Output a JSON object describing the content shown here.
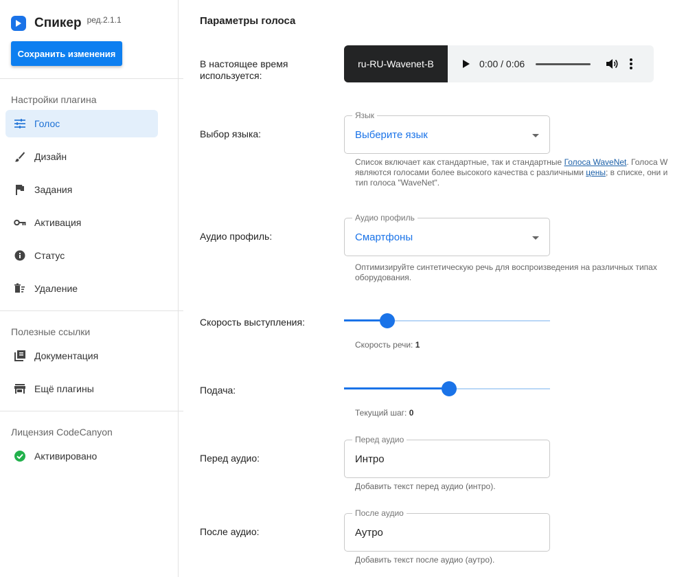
{
  "sidebar": {
    "app_name": "Спикер",
    "version": "ред.2.1.1",
    "save_label": "Сохранить изменения",
    "sections": {
      "plugin_settings": "Настройки плагина",
      "useful_links": "Полезные ссылки",
      "license": "Лицензия CodeCanyon"
    },
    "items": [
      {
        "label": "Голос",
        "icon": "sliders-icon",
        "active": true
      },
      {
        "label": "Дизайн",
        "icon": "brush-icon"
      },
      {
        "label": "Задания",
        "icon": "flag-icon"
      },
      {
        "label": "Активация",
        "icon": "key-icon"
      },
      {
        "label": "Статус",
        "icon": "info-icon"
      },
      {
        "label": "Удаление",
        "icon": "delete-sweep-icon"
      }
    ],
    "links": [
      {
        "label": "Документация",
        "icon": "library-books-icon"
      },
      {
        "label": "Ещё плагины",
        "icon": "store-icon"
      }
    ],
    "license_status": {
      "label": "Активировано",
      "icon": "check-circle-icon"
    }
  },
  "main": {
    "title": "Параметры голоса",
    "current_voice": {
      "label": "В настоящее время используется:",
      "voice": "ru-RU-Wavenet-B",
      "time": "0:00 / 0:06"
    },
    "language": {
      "label": "Выбор языка:",
      "legend": "Язык",
      "value": "Выберите язык",
      "help_1": "Список включает как стандартные, так и стандартные ",
      "help_link1": "Голоса WaveNet",
      "help_2": ". Голоса W",
      "help_3": "являются голосами более высокого качества с различными ",
      "help_link2": "цены",
      "help_4": "; в списке, они и",
      "help_5": "тип голоса \"WaveNet\"."
    },
    "audio_profile": {
      "label": "Аудио профиль:",
      "legend": "Аудио профиль",
      "value": "Смартфоны",
      "help_1": "Оптимизируйте синтетическую речь для воспроизведения на различных типах",
      "help_2": "оборудования."
    },
    "speed": {
      "label": "Скорость выступления:",
      "note": "Скорость речи: ",
      "value": "1",
      "fraction": 0.21
    },
    "pitch": {
      "label": "Подача:",
      "note": "Текущий шаг: ",
      "value": "0",
      "fraction": 0.51
    },
    "before_audio": {
      "label": "Перед аудио:",
      "legend": "Перед аудио",
      "value": "Интро",
      "help": "Добавить текст перед аудио (интро)."
    },
    "after_audio": {
      "label": "После аудио:",
      "legend": "После аудио",
      "value": "Аутро",
      "help": "Добавить текст после аудио (аутро)."
    }
  },
  "colors": {
    "accent": "#1a73e8",
    "active_bg": "#e3effb",
    "success": "#22b14c"
  }
}
